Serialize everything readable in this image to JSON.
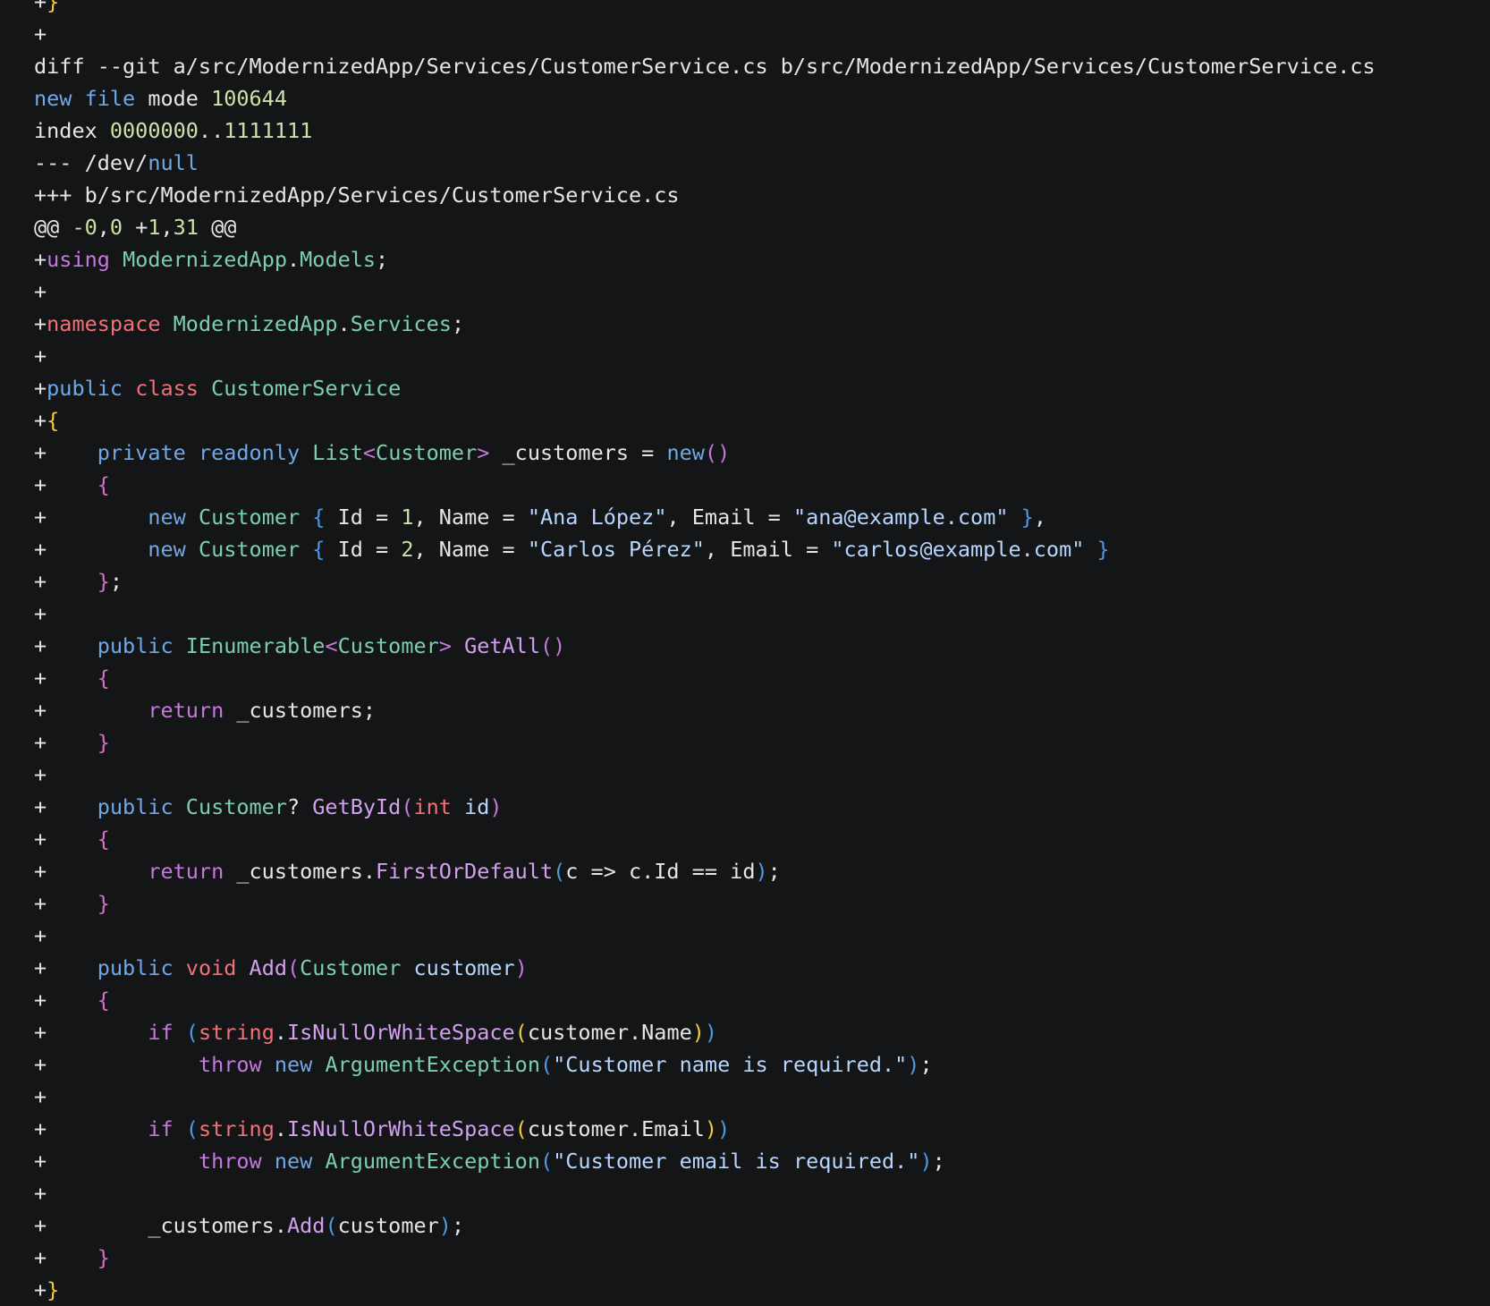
{
  "colors": {
    "background": "#141517",
    "default": "#e6e6e6",
    "kw_blue": "#6fa8e8",
    "kw_purple": "#c678dd",
    "kw_red": "#f07178",
    "type_teal": "#7ccfae",
    "number": "#cfe0a6",
    "string": "#b6d6ff",
    "fn": "#d3a0f0",
    "bracket_yellow": "#f0cf3c",
    "bracket_magenta": "#d470c8",
    "bracket_blue": "#4c9be8"
  },
  "diff": {
    "file_path": "src/ModernizedApp/Services/CustomerService.cs",
    "mode": "100644",
    "index_from": "0000000",
    "index_to": "1111111",
    "hunk": "@@ -0,0 +1,31 @@"
  },
  "lines": [
    [
      [
        "+",
        "default"
      ],
      [
        "}",
        "bracket_yellow"
      ]
    ],
    [
      [
        "+",
        "default"
      ]
    ],
    [
      [
        "diff --git a/src/ModernizedApp/Services/CustomerService.cs b/src/ModernizedApp/Services/CustomerService.cs",
        "default"
      ]
    ],
    [
      [
        "new",
        "kw_blue"
      ],
      [
        " ",
        "default"
      ],
      [
        "file",
        "kw_blue"
      ],
      [
        " mode ",
        "default"
      ],
      [
        "100644",
        "number"
      ]
    ],
    [
      [
        "index ",
        "default"
      ],
      [
        "0000000",
        "number"
      ],
      [
        "..",
        "default"
      ],
      [
        "1111111",
        "number"
      ]
    ],
    [
      [
        "--- /dev/",
        "default"
      ],
      [
        "null",
        "kw_blue"
      ]
    ],
    [
      [
        "+++ b/src/ModernizedApp/Services/CustomerService.cs",
        "default"
      ]
    ],
    [
      [
        "@@ ",
        "default"
      ],
      [
        "-0",
        "number"
      ],
      [
        ",",
        "default"
      ],
      [
        "0",
        "number"
      ],
      [
        " +",
        "default"
      ],
      [
        "1",
        "number"
      ],
      [
        ",",
        "default"
      ],
      [
        "31",
        "number"
      ],
      [
        " @@",
        "default"
      ]
    ],
    [
      [
        "+",
        "default"
      ],
      [
        "using",
        "kw_purple"
      ],
      [
        " ",
        "default"
      ],
      [
        "ModernizedApp",
        "type_teal"
      ],
      [
        ".",
        "default"
      ],
      [
        "Models",
        "type_teal"
      ],
      [
        ";",
        "default"
      ]
    ],
    [
      [
        "+",
        "default"
      ]
    ],
    [
      [
        "+",
        "default"
      ],
      [
        "namespace",
        "kw_red"
      ],
      [
        " ",
        "default"
      ],
      [
        "ModernizedApp",
        "type_teal"
      ],
      [
        ".",
        "default"
      ],
      [
        "Services",
        "type_teal"
      ],
      [
        ";",
        "default"
      ]
    ],
    [
      [
        "+",
        "default"
      ]
    ],
    [
      [
        "+",
        "default"
      ],
      [
        "public",
        "kw_blue"
      ],
      [
        " ",
        "default"
      ],
      [
        "class",
        "kw_red"
      ],
      [
        " ",
        "default"
      ],
      [
        "CustomerService",
        "type_teal"
      ]
    ],
    [
      [
        "+",
        "default"
      ],
      [
        "{",
        "bracket_yellow"
      ]
    ],
    [
      [
        "+    ",
        "default"
      ],
      [
        "private",
        "kw_blue"
      ],
      [
        " ",
        "default"
      ],
      [
        "readonly",
        "kw_blue"
      ],
      [
        " ",
        "default"
      ],
      [
        "List",
        "type_teal"
      ],
      [
        "<",
        "kw_purple"
      ],
      [
        "Customer",
        "type_teal"
      ],
      [
        ">",
        "kw_purple"
      ],
      [
        " _customers = ",
        "default"
      ],
      [
        "new",
        "kw_blue"
      ],
      [
        "()",
        "kw_purple"
      ]
    ],
    [
      [
        "+    ",
        "default"
      ],
      [
        "{",
        "bracket_magenta"
      ]
    ],
    [
      [
        "+        ",
        "default"
      ],
      [
        "new",
        "kw_blue"
      ],
      [
        " ",
        "default"
      ],
      [
        "Customer",
        "type_teal"
      ],
      [
        " ",
        "default"
      ],
      [
        "{",
        "bracket_blue"
      ],
      [
        " Id = ",
        "default"
      ],
      [
        "1",
        "number"
      ],
      [
        ", Name = ",
        "default"
      ],
      [
        "\"Ana López\"",
        "string"
      ],
      [
        ", Email = ",
        "default"
      ],
      [
        "\"ana@example.com\"",
        "string"
      ],
      [
        " ",
        "default"
      ],
      [
        "}",
        "bracket_blue"
      ],
      [
        ",",
        "default"
      ]
    ],
    [
      [
        "+        ",
        "default"
      ],
      [
        "new",
        "kw_blue"
      ],
      [
        " ",
        "default"
      ],
      [
        "Customer",
        "type_teal"
      ],
      [
        " ",
        "default"
      ],
      [
        "{",
        "bracket_blue"
      ],
      [
        " Id = ",
        "default"
      ],
      [
        "2",
        "number"
      ],
      [
        ", Name = ",
        "default"
      ],
      [
        "\"Carlos Pérez\"",
        "string"
      ],
      [
        ", Email = ",
        "default"
      ],
      [
        "\"carlos@example.com\"",
        "string"
      ],
      [
        " ",
        "default"
      ],
      [
        "}",
        "bracket_blue"
      ]
    ],
    [
      [
        "+    ",
        "default"
      ],
      [
        "}",
        "bracket_magenta"
      ],
      [
        ";",
        "default"
      ]
    ],
    [
      [
        "+",
        "default"
      ]
    ],
    [
      [
        "+    ",
        "default"
      ],
      [
        "public",
        "kw_blue"
      ],
      [
        " ",
        "default"
      ],
      [
        "IEnumerable",
        "type_teal"
      ],
      [
        "<",
        "kw_purple"
      ],
      [
        "Customer",
        "type_teal"
      ],
      [
        ">",
        "kw_purple"
      ],
      [
        " ",
        "default"
      ],
      [
        "GetAll",
        "fn"
      ],
      [
        "()",
        "kw_purple"
      ]
    ],
    [
      [
        "+    ",
        "default"
      ],
      [
        "{",
        "bracket_magenta"
      ]
    ],
    [
      [
        "+        ",
        "default"
      ],
      [
        "return",
        "kw_purple"
      ],
      [
        " _customers;",
        "default"
      ]
    ],
    [
      [
        "+    ",
        "default"
      ],
      [
        "}",
        "bracket_magenta"
      ]
    ],
    [
      [
        "+",
        "default"
      ]
    ],
    [
      [
        "+    ",
        "default"
      ],
      [
        "public",
        "kw_blue"
      ],
      [
        " ",
        "default"
      ],
      [
        "Customer",
        "type_teal"
      ],
      [
        "? ",
        "default"
      ],
      [
        "GetById",
        "fn"
      ],
      [
        "(",
        "kw_purple"
      ],
      [
        "int",
        "kw_red"
      ],
      [
        " ",
        "default"
      ],
      [
        "id",
        "string"
      ],
      [
        ")",
        "kw_purple"
      ]
    ],
    [
      [
        "+    ",
        "default"
      ],
      [
        "{",
        "bracket_magenta"
      ]
    ],
    [
      [
        "+        ",
        "default"
      ],
      [
        "return",
        "kw_purple"
      ],
      [
        " _customers.",
        "default"
      ],
      [
        "FirstOrDefault",
        "fn"
      ],
      [
        "(",
        "bracket_blue"
      ],
      [
        "c => c.Id == id",
        "default"
      ],
      [
        ")",
        "bracket_blue"
      ],
      [
        ";",
        "default"
      ]
    ],
    [
      [
        "+    ",
        "default"
      ],
      [
        "}",
        "bracket_magenta"
      ]
    ],
    [
      [
        "+",
        "default"
      ]
    ],
    [
      [
        "+    ",
        "default"
      ],
      [
        "public",
        "kw_blue"
      ],
      [
        " ",
        "default"
      ],
      [
        "void",
        "kw_red"
      ],
      [
        " ",
        "default"
      ],
      [
        "Add",
        "fn"
      ],
      [
        "(",
        "kw_purple"
      ],
      [
        "Customer",
        "type_teal"
      ],
      [
        " ",
        "default"
      ],
      [
        "customer",
        "string"
      ],
      [
        ")",
        "kw_purple"
      ]
    ],
    [
      [
        "+    ",
        "default"
      ],
      [
        "{",
        "bracket_magenta"
      ]
    ],
    [
      [
        "+        ",
        "default"
      ],
      [
        "if",
        "kw_purple"
      ],
      [
        " ",
        "default"
      ],
      [
        "(",
        "bracket_blue"
      ],
      [
        "string",
        "kw_red"
      ],
      [
        ".",
        "default"
      ],
      [
        "IsNullOrWhiteSpace",
        "fn"
      ],
      [
        "(",
        "bracket_yellow"
      ],
      [
        "customer.Name",
        "default"
      ],
      [
        ")",
        "bracket_yellow"
      ],
      [
        ")",
        "bracket_blue"
      ]
    ],
    [
      [
        "+            ",
        "default"
      ],
      [
        "throw",
        "kw_purple"
      ],
      [
        " ",
        "default"
      ],
      [
        "new",
        "kw_blue"
      ],
      [
        " ",
        "default"
      ],
      [
        "ArgumentException",
        "type_teal"
      ],
      [
        "(",
        "bracket_blue"
      ],
      [
        "\"Customer name is required.\"",
        "string"
      ],
      [
        ")",
        "bracket_blue"
      ],
      [
        ";",
        "default"
      ]
    ],
    [
      [
        "+",
        "default"
      ]
    ],
    [
      [
        "+        ",
        "default"
      ],
      [
        "if",
        "kw_purple"
      ],
      [
        " ",
        "default"
      ],
      [
        "(",
        "bracket_blue"
      ],
      [
        "string",
        "kw_red"
      ],
      [
        ".",
        "default"
      ],
      [
        "IsNullOrWhiteSpace",
        "fn"
      ],
      [
        "(",
        "bracket_yellow"
      ],
      [
        "customer.Email",
        "default"
      ],
      [
        ")",
        "bracket_yellow"
      ],
      [
        ")",
        "bracket_blue"
      ]
    ],
    [
      [
        "+            ",
        "default"
      ],
      [
        "throw",
        "kw_purple"
      ],
      [
        " ",
        "default"
      ],
      [
        "new",
        "kw_blue"
      ],
      [
        " ",
        "default"
      ],
      [
        "ArgumentException",
        "type_teal"
      ],
      [
        "(",
        "bracket_blue"
      ],
      [
        "\"Customer email is required.\"",
        "string"
      ],
      [
        ")",
        "bracket_blue"
      ],
      [
        ";",
        "default"
      ]
    ],
    [
      [
        "+",
        "default"
      ]
    ],
    [
      [
        "+        ",
        "default"
      ],
      [
        "_customers.",
        "default"
      ],
      [
        "Add",
        "fn"
      ],
      [
        "(",
        "bracket_blue"
      ],
      [
        "customer",
        "default"
      ],
      [
        ")",
        "bracket_blue"
      ],
      [
        ";",
        "default"
      ]
    ],
    [
      [
        "+    ",
        "default"
      ],
      [
        "}",
        "bracket_magenta"
      ]
    ],
    [
      [
        "+",
        "default"
      ],
      [
        "}",
        "bracket_yellow"
      ]
    ]
  ]
}
